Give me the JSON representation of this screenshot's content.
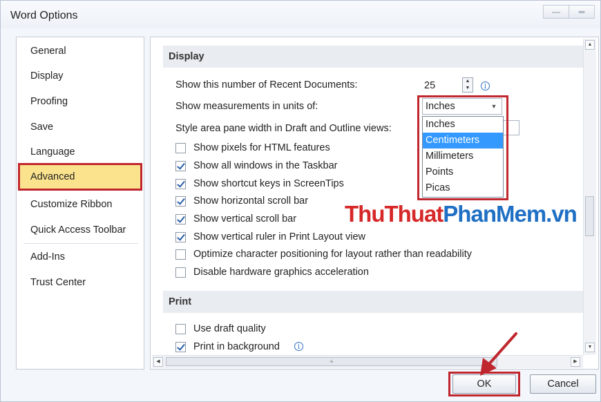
{
  "window": {
    "title": "Word Options",
    "minimize_icon": "minimize-icon",
    "close_icon": "close-icon"
  },
  "nav": {
    "items": [
      "General",
      "Display",
      "Proofing",
      "Save",
      "Language",
      "Advanced",
      "Customize Ribbon",
      "Quick Access Toolbar",
      "Add-Ins",
      "Trust Center"
    ],
    "active": "Advanced"
  },
  "display": {
    "header": "Display",
    "recent_docs_label": "Show this number of Recent Documents:",
    "recent_docs_value": "25",
    "units_label": "Show measurements in units of:",
    "units_selected": "Inches",
    "units_options": [
      "Inches",
      "Centimeters",
      "Millimeters",
      "Points",
      "Picas"
    ],
    "units_highlighted": "Centimeters",
    "style_area_label": "Style area pane width in Draft and Outline views:",
    "checkboxes": [
      {
        "label": "Show pixels for HTML features",
        "checked": false
      },
      {
        "label": "Show all windows in the Taskbar",
        "checked": true
      },
      {
        "label": "Show shortcut keys in ScreenTips",
        "checked": true
      },
      {
        "label": "Show horizontal scroll bar",
        "checked": true
      },
      {
        "label": "Show vertical scroll bar",
        "checked": true
      },
      {
        "label": "Show vertical ruler in Print Layout view",
        "checked": true
      },
      {
        "label": "Optimize character positioning for layout rather than readability",
        "checked": false
      },
      {
        "label": "Disable hardware graphics acceleration",
        "checked": false
      }
    ]
  },
  "print": {
    "header": "Print",
    "checkboxes": [
      {
        "label": "Use draft quality",
        "checked": false
      },
      {
        "label": "Print in background",
        "checked": true
      }
    ]
  },
  "buttons": {
    "ok": "OK",
    "cancel": "Cancel"
  },
  "watermark": {
    "part1": "ThuThuat",
    "part2": "PhanMem.vn"
  },
  "colors": {
    "highlight_red": "#c0262d",
    "active_nav": "#fbe38e",
    "selection_blue": "#3399ff"
  }
}
